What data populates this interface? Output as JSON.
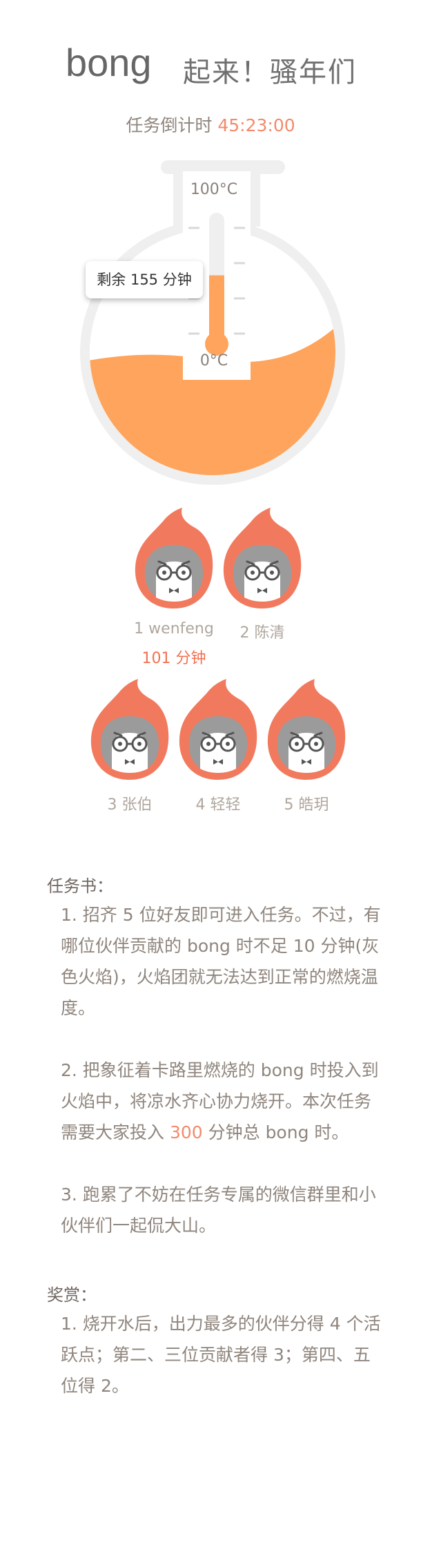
{
  "header": {
    "brand": "bong",
    "headline": "起来！骚年们",
    "countdown_label": "任务倒计时",
    "countdown_time": "45:23:00"
  },
  "thermo": {
    "max_label": "100°C",
    "min_label": "0°C",
    "remaining_text": "剩余 155 分钟",
    "progress_fraction": 0.48,
    "colors": {
      "fill": "#fea45c",
      "flask": "#efefef",
      "mercury": "#fea45c"
    }
  },
  "team": {
    "members": [
      {
        "rank": "1",
        "name": "wenfeng",
        "label": "1 wenfeng",
        "minutes": "101 分钟"
      },
      {
        "rank": "2",
        "name": "陈清",
        "label": "2 陈清"
      },
      {
        "rank": "3",
        "name": "张伯",
        "label": "3 张伯"
      },
      {
        "rank": "4",
        "name": "轻轻",
        "label": "4 轻轻"
      },
      {
        "rank": "5",
        "name": "皓玥",
        "label": "5 皓玥"
      }
    ],
    "colors": {
      "flame": "#f17a5e",
      "face": "#9b9b9b"
    }
  },
  "mission": {
    "title": "任务书：",
    "p1": "1. 招齐 5 位好友即可进入任务。不过，有哪位伙伴贡献的 bong 时不足 10 分钟(灰色火焰)，火焰团就无法达到正常的燃烧温度。",
    "p2_before": "2. 把象征着卡路里燃烧的 bong 时投入到火焰中，将凉水齐心协力烧开。本次任务需要大家投入 ",
    "p2_highlight": "300",
    "p2_after": " 分钟总 bong 时。",
    "p3": "3. 跑累了不妨在任务专属的微信群里和小伙伴们一起侃大山。"
  },
  "reward": {
    "title": "奖赏：",
    "p1": "1. 烧开水后，出力最多的伙伴分得 4 个活跃点；第二、三位贡献者得 3；第四、五位得 2。"
  }
}
